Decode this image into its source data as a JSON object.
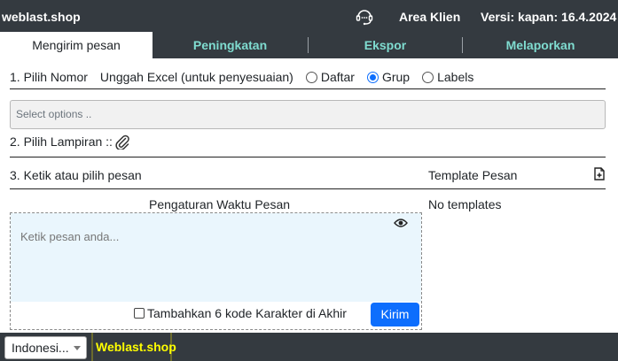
{
  "header": {
    "brand": "weblast.shop",
    "area_label": "Area Klien",
    "version_label": "Versi: kapan: 16.4.2024"
  },
  "tabs": [
    {
      "label": "Mengirim pesan",
      "active": true
    },
    {
      "label": "Peningkatan",
      "active": false
    },
    {
      "label": "Ekspor",
      "active": false
    },
    {
      "label": "Melaporkan",
      "active": false
    }
  ],
  "step1": {
    "label": "1. Pilih Nomor",
    "upload_label": "Unggah Excel (untuk penyesuaian)",
    "options": [
      {
        "label": "Daftar",
        "checked": false
      },
      {
        "label": "Grup",
        "checked": true
      },
      {
        "label": "Labels",
        "checked": false
      }
    ],
    "select_placeholder": "Select options .."
  },
  "step2": {
    "label": "2. Pilih Lampiran ::"
  },
  "step3": {
    "label": "3. Ketik atau pilih pesan",
    "schedule_label": "Pengaturan Waktu Pesan",
    "message_placeholder": "Ketik pesan anda...",
    "append_code_label": "Tambahkan 6 kode Karakter di Akhir",
    "append_code_checked": false,
    "send_label": "Kirim"
  },
  "templates": {
    "title": "Template Pesan",
    "empty_text": "No templates"
  },
  "footer": {
    "language": "Indonesi...",
    "brand": "Weblast.shop"
  },
  "colors": {
    "bar_bg": "#343a40",
    "tab_text": "#7fdcd0",
    "primary": "#0d6efd",
    "message_bg": "#eaf6fd",
    "footer_brand": "#ffff00"
  }
}
